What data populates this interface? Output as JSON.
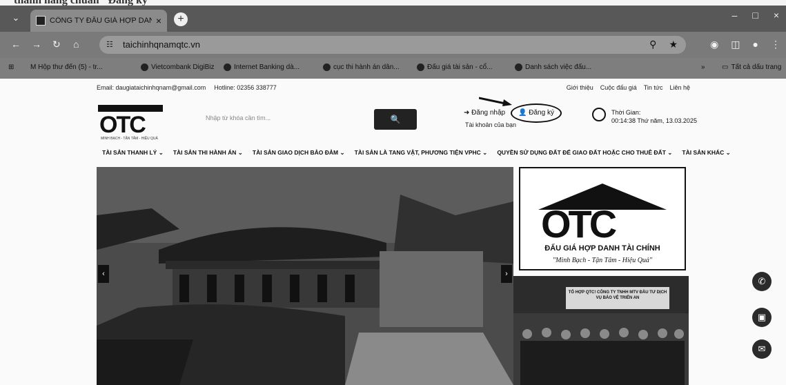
{
  "browser": {
    "tab_title": "CÔNG TY ĐẤU GIÁ HỢP DANH...",
    "tab_close": "×",
    "new_tab": "+",
    "minimize": "–",
    "close_window": "×",
    "url": "taichinhqnamqtc.vn",
    "bookmarks": [
      "M Hộp thư đến (5) - tr...",
      "Vietcombank DigiBiz",
      "Internet Banking dà...",
      "cục thi hành án dân...",
      "Đấu giá tài sản - cổ...",
      "Danh sách việc đấu..."
    ],
    "bookmarks_all": "Tất cả dấu trang"
  },
  "site": {
    "email": "Email: daugiataichinhqnam@gmail.com",
    "hotline": "Hotline: 02356 338777",
    "top_links": [
      "Giới thiệu",
      "Cuộc đấu giá",
      "Tin tức",
      "Liên hệ"
    ],
    "logo_text": "OTC",
    "logo_sub": "MINH BẠCH - TẬN TÂM - HIỆU QUẢ",
    "search_placeholder": "Nhập từ khóa cần tìm...",
    "search_icon": "🔍",
    "login": "Đăng nhập",
    "register": "Đăng ký",
    "login_sub": "Tài khoản của bạn",
    "time_label": "Thời Gian:",
    "time_value": "00:14:38 Thứ năm, 13.03.2025",
    "menu": [
      "TÀI SẢN THANH LÝ ⌄",
      "TÀI SẢN THI HÀNH ÁN ⌄",
      "TÀI SẢN GIAO DỊCH BẢO ĐẢM ⌄",
      "TÀI SẢN LÀ TANG VẬT, PHƯƠNG TIỆN VPHC ⌄",
      "QUYỀN SỬ DỤNG ĐẤT ĐỂ GIAO ĐẤT HOẶC CHO THUÊ ĐẤT ⌄",
      "TÀI SẢN KHÁC ⌄"
    ],
    "slide_prev": "‹",
    "slide_next": "›",
    "side_logo_text": "OTC",
    "side_company": "ĐẤU GIÁ HỢP DANH TÀI CHÍNH",
    "side_slogan": "\"Minh Bạch - Tận Tâm - Hiệu Quả\"",
    "photo_sign": "TỔ HỢP QTC! CÔNG TY TNHH MTV ĐẦU TƯ DỊCH VỤ BẢO VỆ TRIỂN AN"
  }
}
